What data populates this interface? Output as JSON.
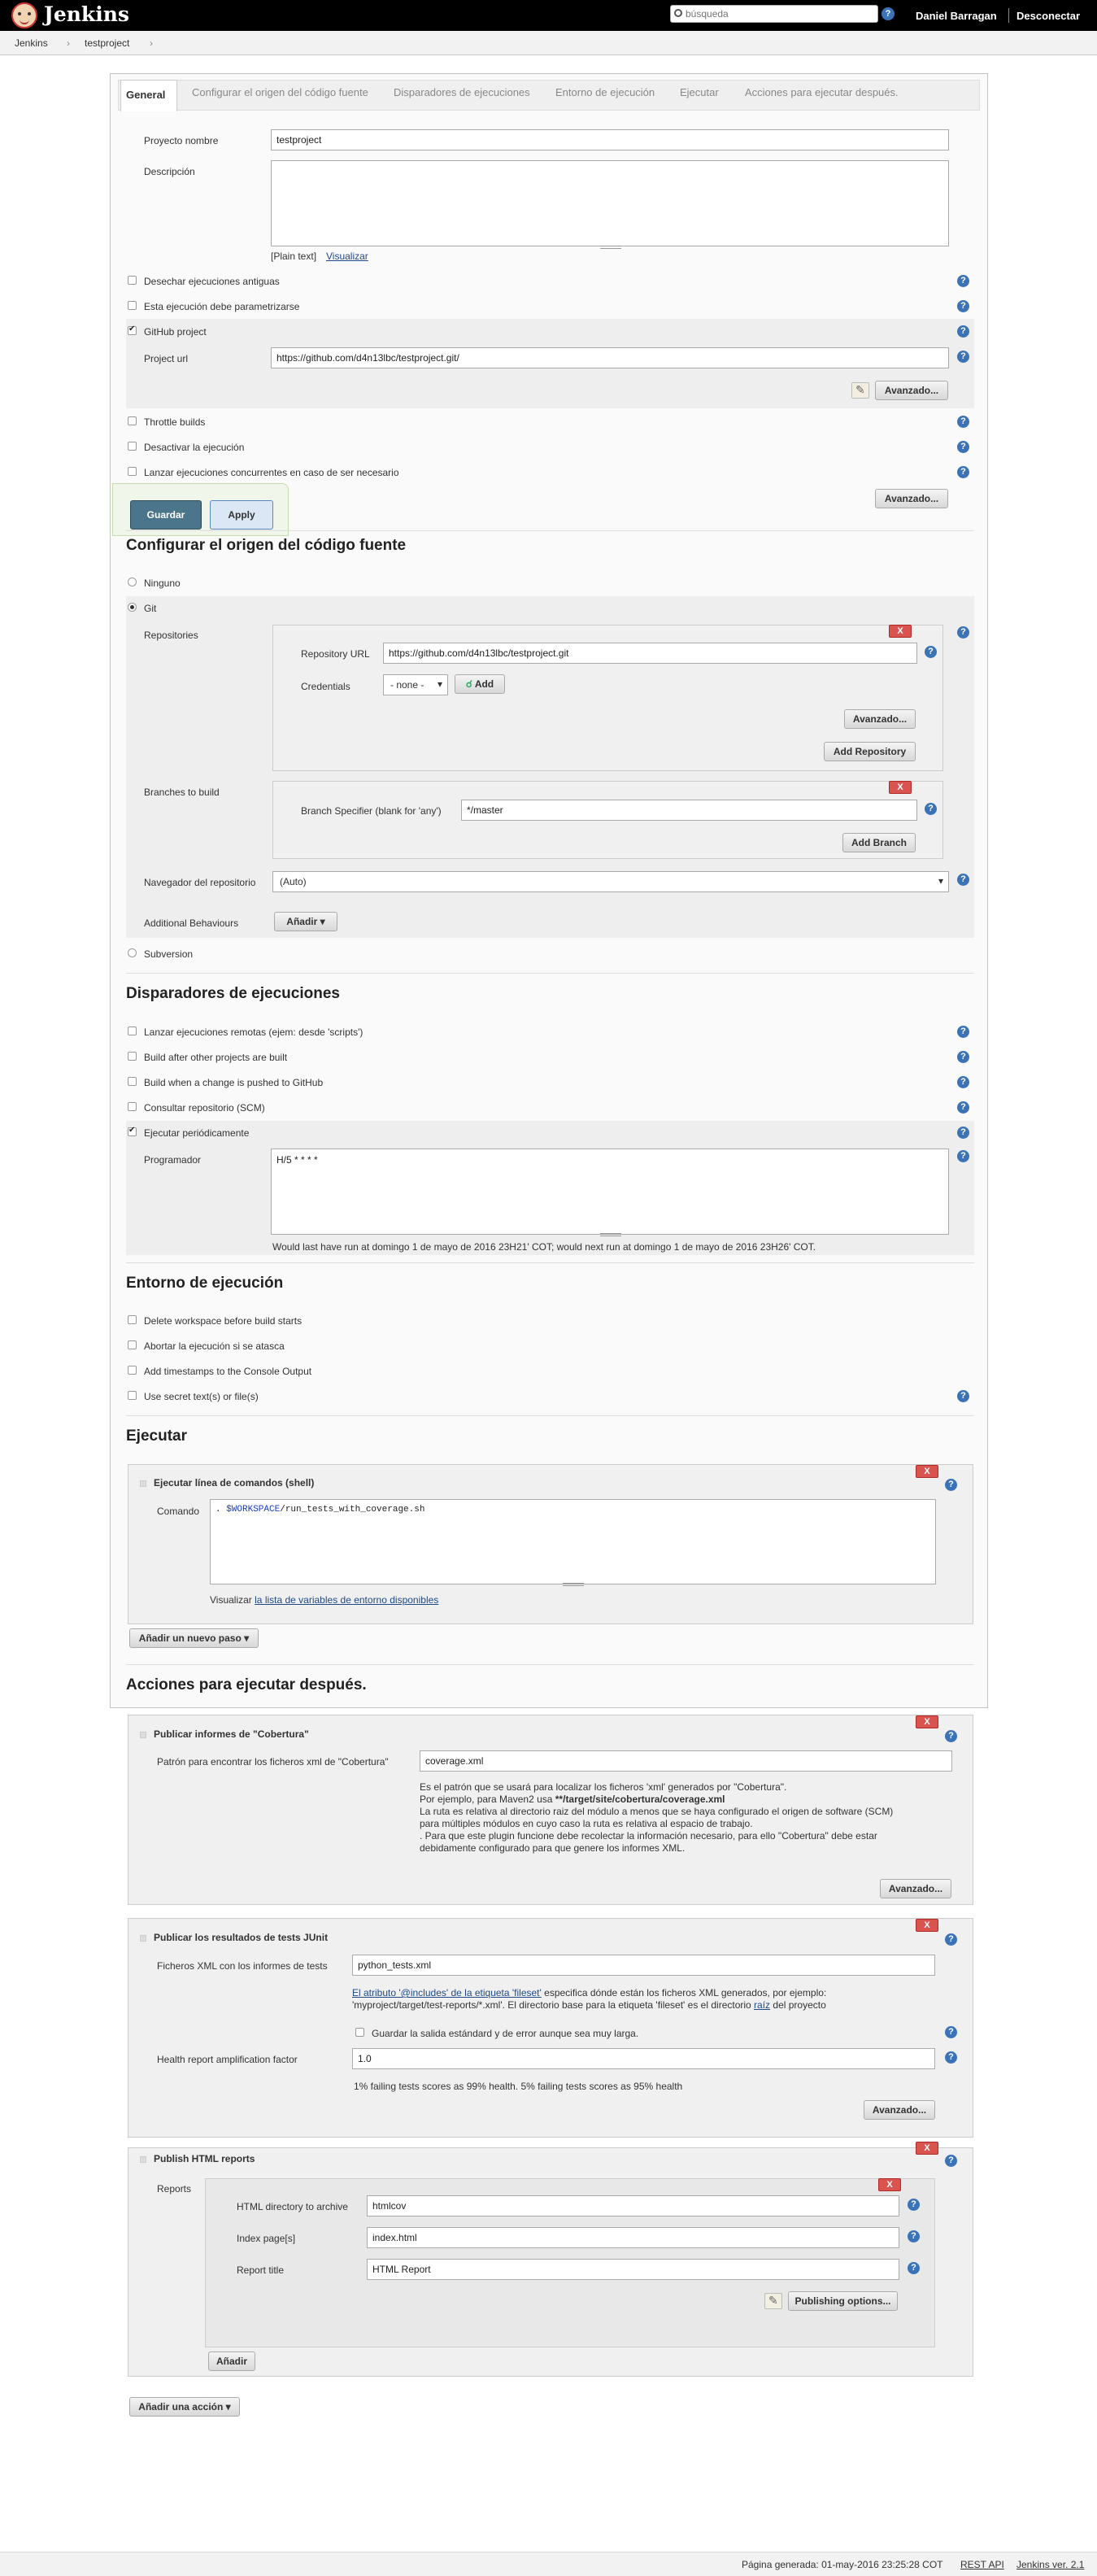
{
  "header": {
    "app_name": "Jenkins",
    "search_placeholder": "búsqueda",
    "help": "?",
    "user": "Daniel Barragan",
    "logout": "Desconectar"
  },
  "breadcrumb": {
    "items": [
      "Jenkins",
      "testproject"
    ],
    "sep": "›"
  },
  "tabs": [
    "General",
    "Configurar el origen del código fuente",
    "Disparadores de ejecuciones",
    "Entorno de ejecución",
    "Ejecutar",
    "Acciones para ejecutar después."
  ],
  "general": {
    "project_name_label": "Proyecto nombre",
    "project_name": "testproject",
    "description_label": "Descripción",
    "description": "",
    "plain_text": "[Plain text]",
    "preview": "Visualizar",
    "options": [
      "Desechar ejecuciones antiguas",
      "Esta ejecución debe parametrizarse",
      "GitHub project"
    ],
    "project_url_label": "Project url",
    "project_url": "https://github.com/d4n13lbc/testproject.git/",
    "advanced": "Avanzado...",
    "options2": [
      "Throttle builds",
      "Desactivar la ejecución",
      "Lanzar ejecuciones concurrentes en caso de ser necesario"
    ],
    "advanced2": "Avanzado..."
  },
  "savebar": {
    "save": "Guardar",
    "apply": "Apply"
  },
  "scm": {
    "title": "Configurar el origen del código fuente",
    "none": "Ninguno",
    "git": "Git",
    "repositories_label": "Repositories",
    "repo_url_label": "Repository URL",
    "repo_url": "https://github.com/d4n13lbc/testproject.git",
    "credentials_label": "Credentials",
    "credentials_value": "- none -",
    "add": "Add",
    "advanced": "Avanzado...",
    "add_repository": "Add Repository",
    "branches_label": "Branches to build",
    "branch_spec_label": "Branch Specifier (blank for 'any')",
    "branch_spec": "*/master",
    "add_branch": "Add Branch",
    "browser_label": "Navegador del repositorio",
    "browser_value": "(Auto)",
    "behaviours_label": "Additional Behaviours",
    "add_behaviour": "Añadir",
    "subversion": "Subversion",
    "x": "X"
  },
  "triggers": {
    "title": "Disparadores de ejecuciones",
    "options": [
      "Lanzar ejecuciones remotas (ejem: desde 'scripts')",
      "Build after other projects are built",
      "Build when a change is pushed to GitHub",
      "Consultar repositorio (SCM)",
      "Ejecutar periódicamente"
    ],
    "schedule_label": "Programador",
    "schedule": "H/5 * * * *",
    "note": "Would last have run at domingo 1 de mayo de 2016 23H21' COT; would next run at domingo 1 de mayo de 2016 23H26' COT."
  },
  "env": {
    "title": "Entorno de ejecución",
    "options": [
      "Delete workspace before build starts",
      "Abortar la ejecución si se atasca",
      "Add timestamps to the Console Output",
      "Use secret text(s) or file(s)"
    ]
  },
  "build": {
    "title": "Ejecutar",
    "step_title": "Ejecutar línea de comandos (shell)",
    "command_label": "Comando",
    "command_prefix": ". ",
    "command_var": "$WORKSPACE",
    "command_rest": "/run_tests_with_coverage.sh",
    "see_prefix": "Visualizar ",
    "see_link": "la lista de variables de entorno disponibles",
    "add_step": "Añadir un nuevo paso",
    "x": "X"
  },
  "post": {
    "title": "Acciones para ejecutar después.",
    "cobertura": {
      "title": "Publicar informes de \"Cobertura\"",
      "pattern_label": "Patrón para encontrar los ficheros xml de \"Cobertura\"",
      "pattern": "coverage.xml",
      "help1": "Es el patrón que se usará para localizar los ficheros 'xml' generados por \"Cobertura\".",
      "help2_prefix": "Por ejemplo, para Maven2 usa ",
      "help2_bold": "**/target/site/cobertura/coverage.xml",
      "help3": "La ruta es relativa al directorio raiz del módulo a menos que se haya configurado el origen de software (SCM)",
      "help4": "para múltiples módulos en cuyo caso la ruta es relativa al espacio de trabajo.",
      "help5": ". Para que este plugin funcione debe recolectar la información necesario, para ello \"Cobertura\" debe estar",
      "help6": "debidamente configurado para que genere los informes XML.",
      "advanced": "Avanzado..."
    },
    "junit": {
      "title": "Publicar los resultados de tests JUnit",
      "xml_label": "Ficheros XML con los informes de tests",
      "xml": "python_tests.xml",
      "help_link": "El atributo '@includes' de la etiqueta 'fileset'",
      "help_rest1": " especifica dónde están los ficheros XML generados, por ejemplo:",
      "help_rest2_prefix": "'myproject/target/test-reports/*.xml'. El directorio base para la etiqueta 'fileset' es el directorio ",
      "help_raiz": "raíz",
      "help_rest2_suffix": " del proyecto",
      "keep_output": "Guardar la salida estándard y de error aunque sea muy larga.",
      "factor_label": "Health report amplification factor",
      "factor": "1.0",
      "factor_note": "1% failing tests scores as 99% health. 5% failing tests scores as 95% health",
      "advanced": "Avanzado..."
    },
    "html": {
      "title": "Publish HTML reports",
      "reports_label": "Reports",
      "dir_label": "HTML directory to archive",
      "dir": "htmlcov",
      "index_label": "Index page[s]",
      "index": "index.html",
      "report_title_label": "Report title",
      "report_title": "HTML Report",
      "publishing_options": "Publishing options...",
      "add": "Añadir"
    },
    "add_action": "Añadir una acción",
    "x": "X"
  },
  "footer": {
    "generated": "Página generada: 01-may-2016 23:25:28 COT",
    "rest_api": "REST API",
    "version": "Jenkins ver. 2.1"
  }
}
